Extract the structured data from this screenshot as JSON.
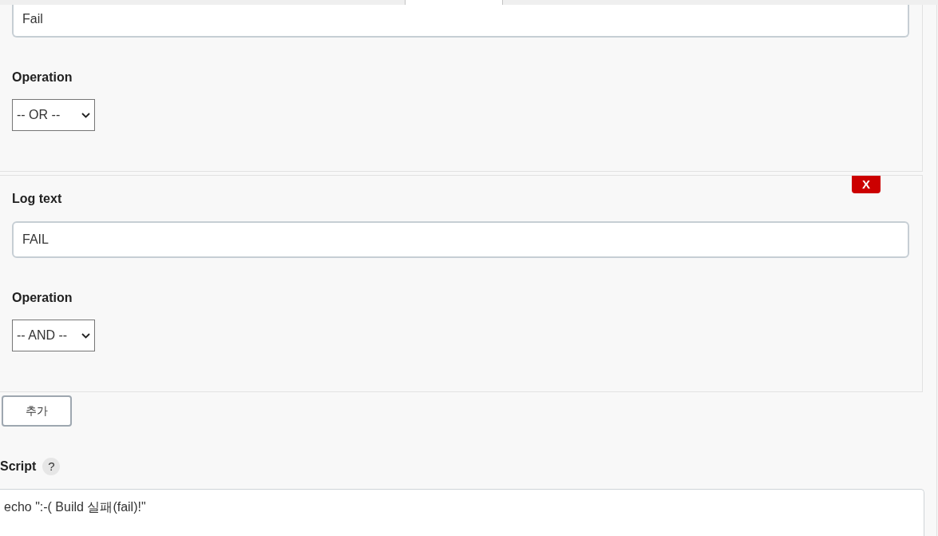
{
  "conditions": [
    {
      "field": {
        "value": "Fail"
      },
      "operation": {
        "label": "Operation",
        "value": "-- OR --"
      }
    },
    {
      "delete_button": "X",
      "field": {
        "label": "Log text",
        "value": "FAIL"
      },
      "operation": {
        "label": "Operation",
        "value": "-- AND --"
      }
    }
  ],
  "add_button": "추가",
  "script": {
    "label": "Script",
    "help": "?",
    "value": "echo \":-( Build 실패(fail)!\""
  }
}
